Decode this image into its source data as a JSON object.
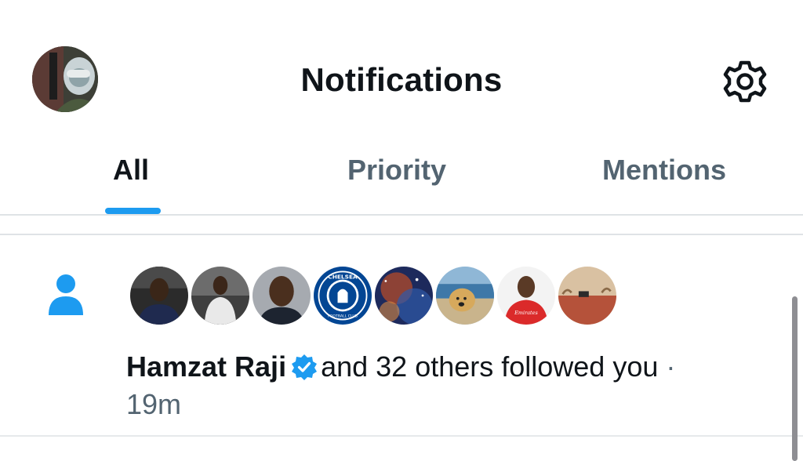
{
  "header": {
    "title": "Notifications",
    "avatar_icon": "user-avatar",
    "settings_icon": "gear-icon"
  },
  "tabs": [
    {
      "label": "All",
      "active": true
    },
    {
      "label": "Priority",
      "active": false
    },
    {
      "label": "Mentions",
      "active": false
    }
  ],
  "notification": {
    "type_icon": "person-icon",
    "name": "Hamzat Raji",
    "verified": true,
    "message": "and 32 others followed you",
    "separator": "·",
    "time": "19m",
    "follower_avatar_count": 8
  },
  "chelsea_badge": {
    "top_text": "CHELSEA",
    "bottom_text": "FOOTBALL CLUB"
  },
  "jersey_sponsor": "Emirates",
  "colors": {
    "accent": "#1d9bf0",
    "text_primary": "#0f1419",
    "text_secondary": "#536471",
    "divider": "#dfe3e6"
  }
}
